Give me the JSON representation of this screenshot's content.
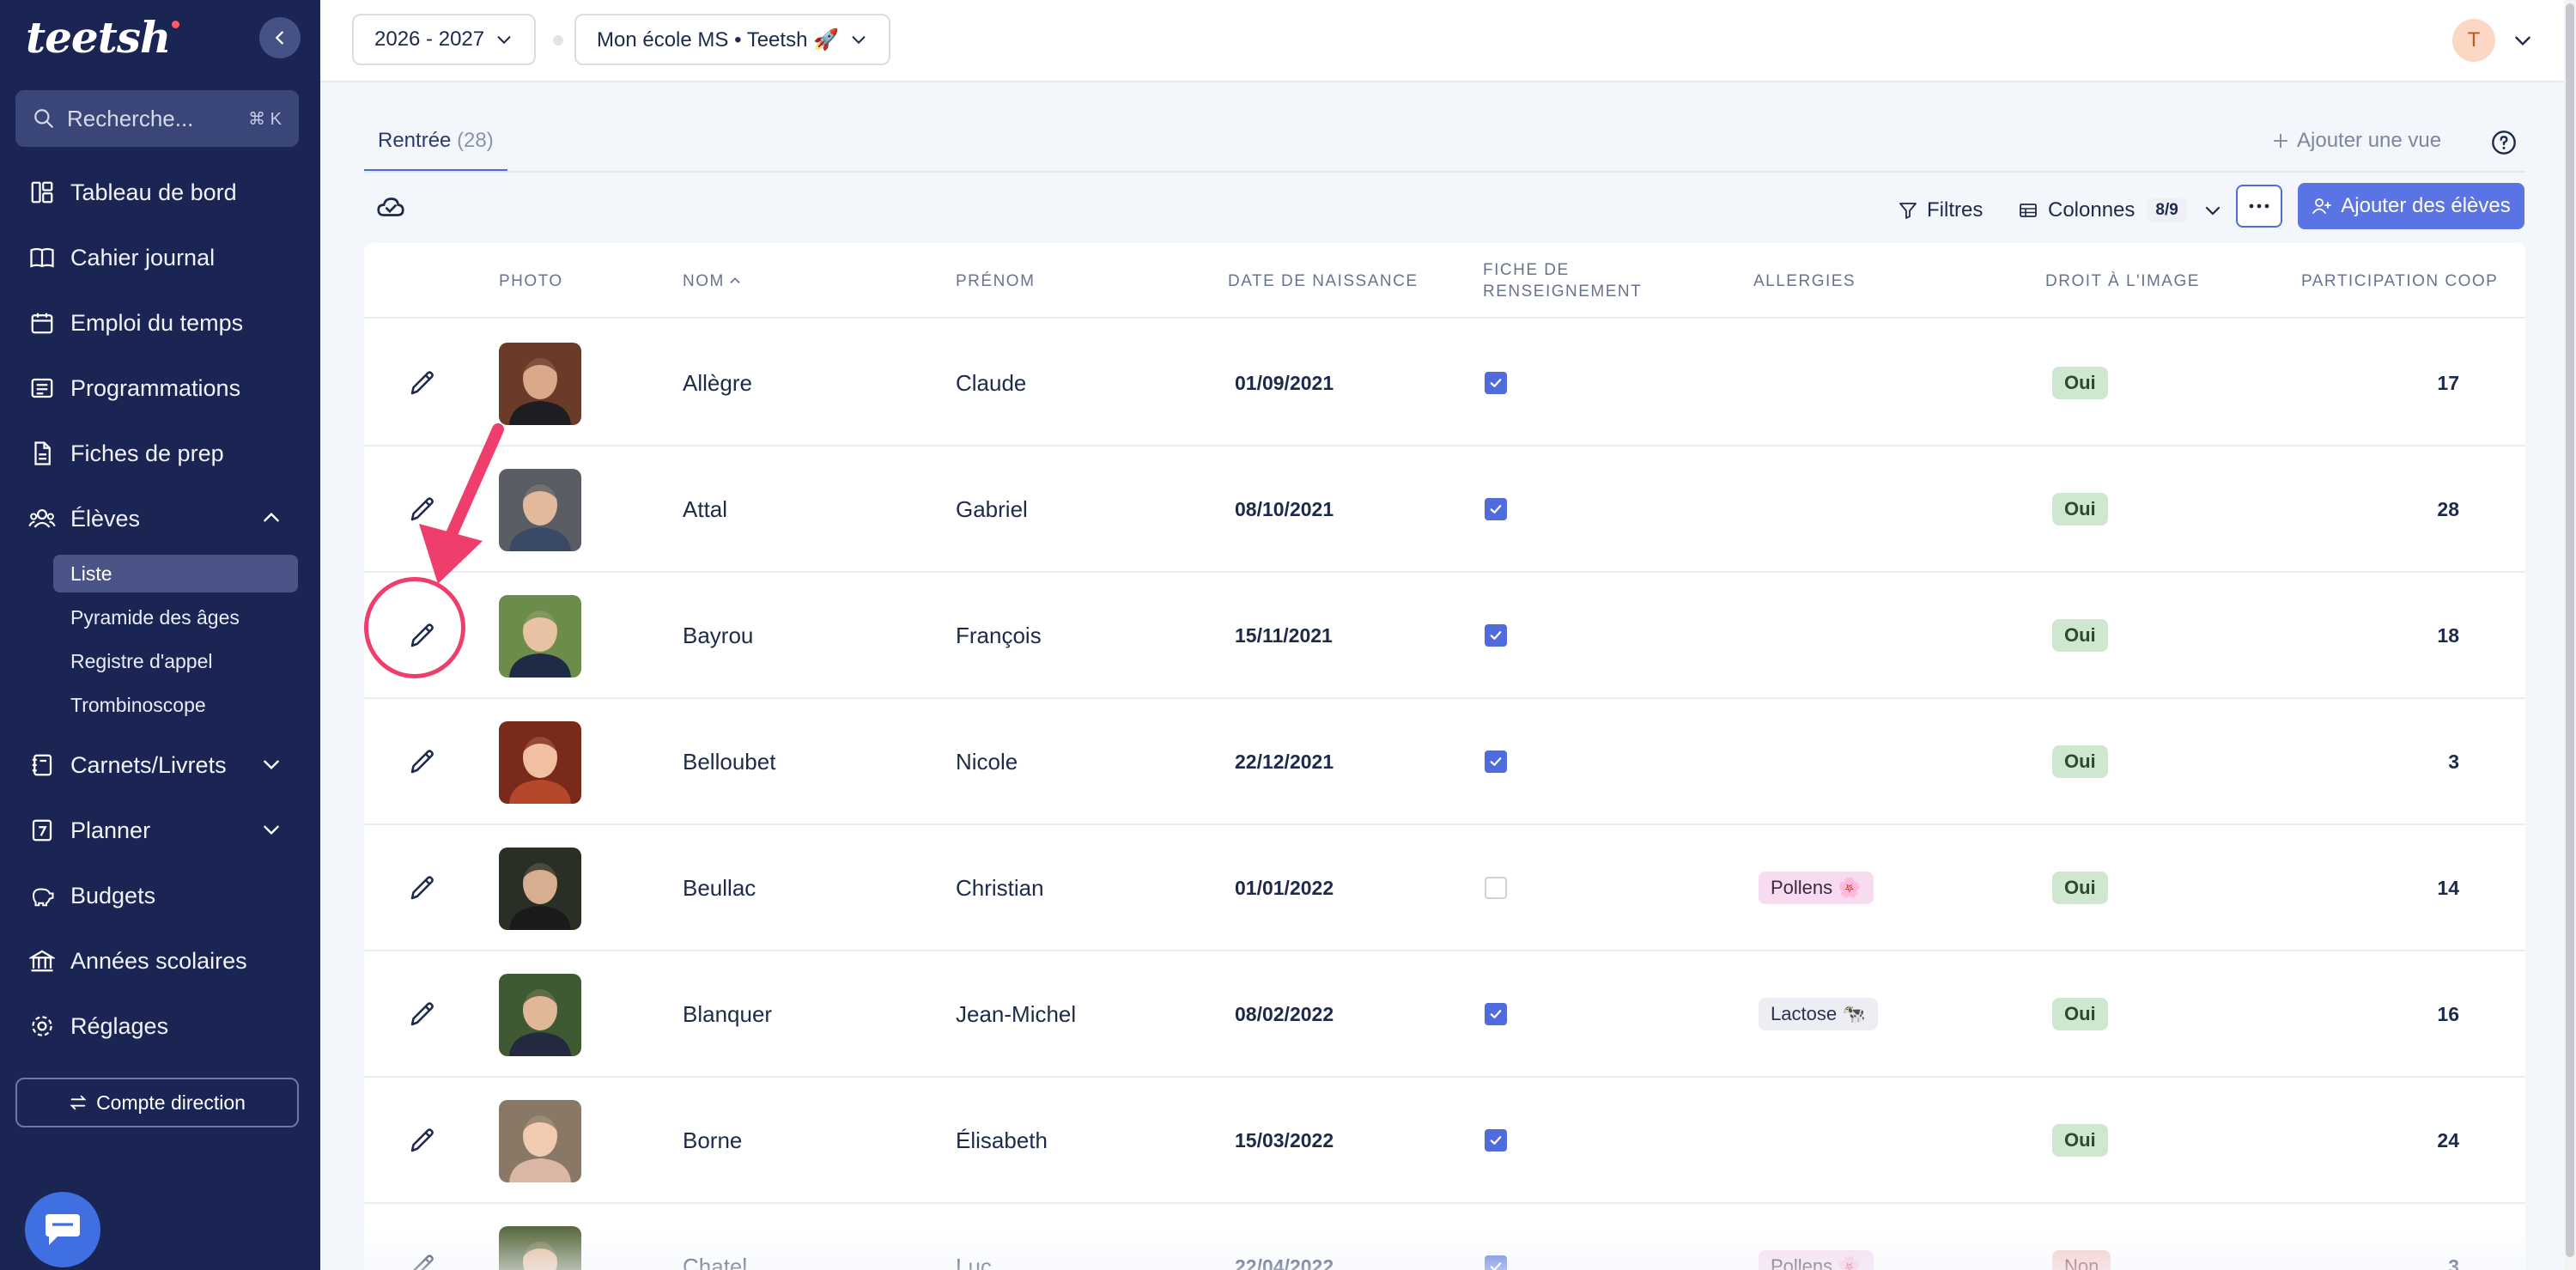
{
  "app": {
    "logo": "teetsh"
  },
  "sidebar": {
    "search_placeholder": "Recherche...",
    "search_shortcut": "⌘ K",
    "items": [
      {
        "label": "Tableau de bord",
        "icon": "dashboard-icon"
      },
      {
        "label": "Cahier journal",
        "icon": "book-icon"
      },
      {
        "label": "Emploi du temps",
        "icon": "calendar-icon"
      },
      {
        "label": "Programmations",
        "icon": "list-icon"
      },
      {
        "label": "Fiches de prep",
        "icon": "document-icon"
      },
      {
        "label": "Élèves",
        "icon": "users-icon",
        "expanded": true
      },
      {
        "label": "Carnets/Livrets",
        "icon": "notebook-icon"
      },
      {
        "label": "Planner",
        "icon": "planner-icon"
      },
      {
        "label": "Budgets",
        "icon": "piggy-bank-icon"
      },
      {
        "label": "Années scolaires",
        "icon": "school-icon"
      },
      {
        "label": "Réglages",
        "icon": "gear-icon"
      }
    ],
    "sub_items": [
      "Liste",
      "Pyramide des âges",
      "Registre d'appel",
      "Trombinoscope"
    ],
    "direction_button": "Compte direction"
  },
  "topbar": {
    "year_selector": "2026 - 2027",
    "class_selector": "Mon école MS • Teetsh 🚀",
    "avatar_initial": "T"
  },
  "tabs": {
    "active_label": "Rentrée",
    "active_count": "(28)",
    "add_view": "Ajouter une vue"
  },
  "toolbar": {
    "filters": "Filtres",
    "columns": "Colonnes",
    "columns_count": "8/9",
    "add_students": "Ajouter des élèves"
  },
  "table": {
    "headers": {
      "photo": "PHOTO",
      "nom": "NOM",
      "prenom": "PRÉNOM",
      "date": "DATE DE NAISSANCE",
      "fiche_1": "FICHE DE",
      "fiche_2": "RENSEIGNEMENT",
      "allergies": "ALLERGIES",
      "droit": "DROIT À L'IMAGE",
      "coop": "PARTICIPATION COOP"
    },
    "rows": [
      {
        "nom": "Allègre",
        "prenom": "Claude",
        "date": "01/09/2021",
        "fiche": true,
        "allergie": "",
        "droit": "Oui",
        "coop": "17"
      },
      {
        "nom": "Attal",
        "prenom": "Gabriel",
        "date": "08/10/2021",
        "fiche": true,
        "allergie": "",
        "droit": "Oui",
        "coop": "28"
      },
      {
        "nom": "Bayrou",
        "prenom": "François",
        "date": "15/11/2021",
        "fiche": true,
        "allergie": "",
        "droit": "Oui",
        "coop": "18"
      },
      {
        "nom": "Belloubet",
        "prenom": "Nicole",
        "date": "22/12/2021",
        "fiche": true,
        "allergie": "",
        "droit": "Oui",
        "coop": "3"
      },
      {
        "nom": "Beullac",
        "prenom": "Christian",
        "date": "01/01/2022",
        "fiche": false,
        "allergie": "Pollens 🌸",
        "droit": "Oui",
        "coop": "14"
      },
      {
        "nom": "Blanquer",
        "prenom": "Jean-Michel",
        "date": "08/02/2022",
        "fiche": true,
        "allergie": "Lactose 🐄",
        "droit": "Oui",
        "coop": "16"
      },
      {
        "nom": "Borne",
        "prenom": "Élisabeth",
        "date": "15/03/2022",
        "fiche": true,
        "allergie": "",
        "droit": "Oui",
        "coop": "24"
      },
      {
        "nom": "Chatel",
        "prenom": "Luc",
        "date": "22/04/2022",
        "fiche": true,
        "allergie": "Pollens 🌸",
        "droit": "Non",
        "coop": "3"
      }
    ]
  },
  "colors": {
    "sidebar_bg": "#1a2554",
    "accent": "#5b74e4",
    "annotation": "#ef3e6b",
    "oui_bg": "#cfe6cf",
    "non_bg": "#f6c9c9"
  }
}
